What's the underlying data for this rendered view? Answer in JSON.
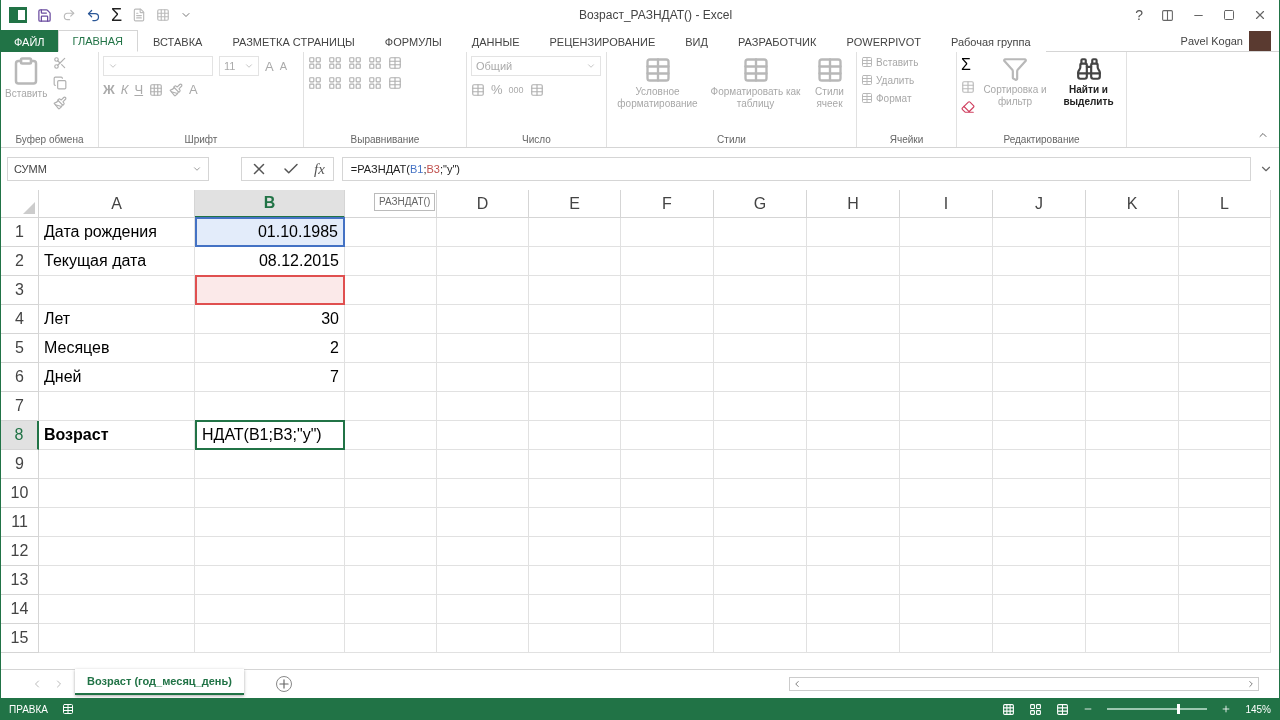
{
  "window": {
    "title": "Возраст_РАЗНДАТ() - Excel",
    "help": "?"
  },
  "quick_access": {
    "sum": "Σ"
  },
  "tabs": [
    {
      "label": "ФАЙЛ",
      "kind": "file",
      "selected": false
    },
    {
      "label": "ГЛАВНАЯ",
      "kind": "tab",
      "selected": true
    },
    {
      "label": "ВСТАВКА",
      "kind": "tab",
      "selected": false
    },
    {
      "label": "РАЗМЕТКА СТРАНИЦЫ",
      "kind": "tab",
      "selected": false
    },
    {
      "label": "ФОРМУЛЫ",
      "kind": "tab",
      "selected": false
    },
    {
      "label": "ДАННЫЕ",
      "kind": "tab",
      "selected": false
    },
    {
      "label": "РЕЦЕНЗИРОВАНИЕ",
      "kind": "tab",
      "selected": false
    },
    {
      "label": "ВИД",
      "kind": "tab",
      "selected": false
    },
    {
      "label": "РАЗРАБОТЧИК",
      "kind": "tab",
      "selected": false
    },
    {
      "label": "POWERPIVOT",
      "kind": "tab",
      "selected": false
    },
    {
      "label": "Рабочая группа",
      "kind": "tab",
      "selected": false
    }
  ],
  "user": {
    "name": "Pavel Kogan"
  },
  "ribbon": {
    "clipboard": {
      "label": "Буфер обмена",
      "paste": "Вставить",
      "disabled": true
    },
    "font": {
      "label": "Шрифт",
      "size": "11",
      "grow": "A",
      "shrink": "A",
      "bold": "Ж",
      "italic": "К",
      "underline": "Ч",
      "font_color_glyph": "A",
      "disabled": true
    },
    "alignment": {
      "label": "Выравнивание",
      "disabled": true
    },
    "number": {
      "label": "Число",
      "format": "Общий",
      "percent": "%",
      "thousands": "000",
      "disabled": true
    },
    "styles": {
      "label": "Стили",
      "items": [
        {
          "label": "Условное форматирование",
          "disabled": true
        },
        {
          "label": "Форматировать как таблицу",
          "disabled": true
        },
        {
          "label": "Стили ячеек",
          "disabled": true
        }
      ]
    },
    "cells": {
      "label": "Ячейки",
      "items": [
        {
          "label": "Вставить",
          "disabled": true
        },
        {
          "label": "Удалить",
          "disabled": true
        },
        {
          "label": "Формат",
          "disabled": true
        }
      ]
    },
    "editing": {
      "label": "Редактирование",
      "sum": "Σ",
      "items": [
        {
          "label": "Сортировка и фильтр",
          "disabled": true
        },
        {
          "label": "Найти и выделить",
          "disabled": false
        }
      ]
    }
  },
  "formula_bar": {
    "name_box": "СУММ",
    "fx": "fx",
    "formula_parts": [
      {
        "text": "=РАЗНДАТ("
      },
      {
        "text": "B1",
        "color": "#4472c4"
      },
      {
        "text": ";"
      },
      {
        "text": "B3",
        "color": "#c0504d"
      },
      {
        "text": ";\"y\")"
      }
    ]
  },
  "sheet": {
    "columns": [
      {
        "label": "A",
        "selected": false
      },
      {
        "label": "B",
        "selected": true
      },
      {
        "selected": false
      },
      {
        "label": "D",
        "selected": false
      },
      {
        "label": "E",
        "selected": false
      },
      {
        "label": "F",
        "selected": false
      },
      {
        "label": "G",
        "selected": false
      },
      {
        "label": "H",
        "selected": false
      },
      {
        "label": "I",
        "selected": false
      },
      {
        "label": "J",
        "selected": false
      },
      {
        "label": "K",
        "selected": false
      },
      {
        "label": "L",
        "selected": false
      }
    ],
    "tooltip": "РАЗНДАТ()",
    "rows": [
      {
        "label": "1",
        "selected": false,
        "cells": [
          {
            "text": "Дата рождения",
            "kind": "text"
          },
          {
            "text": "01.10.1985",
            "kind": "number",
            "color": "#4472c4"
          }
        ]
      },
      {
        "label": "2",
        "selected": false,
        "cells": [
          {
            "text": "Текущая дата",
            "kind": "text"
          },
          {
            "text": "08.12.2015",
            "kind": "number"
          }
        ]
      },
      {
        "label": "3",
        "selected": false,
        "cells": [
          {
            "kind": "text"
          },
          {
            "kind": "number",
            "color": "#e05050"
          }
        ]
      },
      {
        "label": "4",
        "selected": false,
        "cells": [
          {
            "text": "Лет",
            "kind": "text"
          },
          {
            "text": "30",
            "kind": "number"
          }
        ]
      },
      {
        "label": "5",
        "selected": false,
        "cells": [
          {
            "text": "Месяцев",
            "kind": "text"
          },
          {
            "text": "2",
            "kind": "number"
          }
        ]
      },
      {
        "label": "6",
        "selected": false,
        "cells": [
          {
            "text": "Дней",
            "kind": "text"
          },
          {
            "text": "7",
            "kind": "number"
          }
        ]
      },
      {
        "label": "7",
        "selected": false,
        "cells": []
      },
      {
        "label": "8",
        "selected": true,
        "cells": [
          {
            "text": "Возраст",
            "kind": "text",
            "bold": true
          },
          {
            "text": "НДАТ(B1;B3;\"y\")",
            "kind": "text",
            "color": "#217346"
          }
        ]
      },
      {
        "label": "9",
        "selected": false,
        "cells": []
      },
      {
        "label": "10",
        "selected": false,
        "cells": []
      },
      {
        "label": "11",
        "selected": false,
        "cells": []
      },
      {
        "label": "12",
        "selected": false,
        "cells": []
      },
      {
        "label": "13",
        "selected": false,
        "cells": []
      },
      {
        "label": "14",
        "selected": false,
        "cells": []
      },
      {
        "label": "15",
        "selected": false,
        "cells": []
      }
    ]
  },
  "sheet_tabs": [
    {
      "label": "Возраст (год_месяц_день)",
      "selected": true
    }
  ],
  "status_bar": {
    "mode": "ПРАВКА",
    "zoom": "145%",
    "level": 0.7
  }
}
